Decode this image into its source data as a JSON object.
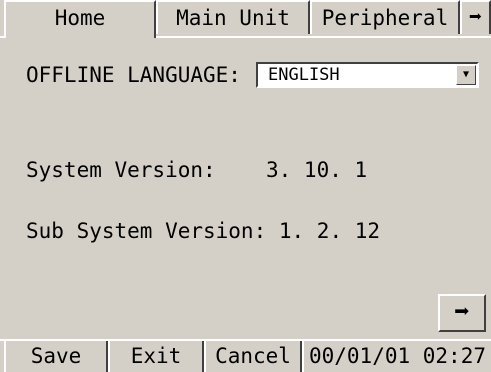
{
  "tabs": {
    "home": "Home",
    "main_unit": "Main Unit",
    "peripheral": "Peripheral",
    "more_icon": "right-arrow"
  },
  "settings": {
    "offline_language_label": "OFFLINE LANGUAGE:",
    "offline_language_value": "ENGLISH",
    "system_version_label": "System Version:",
    "system_version_value": "3. 10. 1",
    "sub_system_version_label": "Sub System Version:",
    "sub_system_version_value": "1. 2. 12"
  },
  "footer": {
    "save": "Save",
    "exit": "Exit",
    "cancel": "Cancel",
    "datetime": "00/01/01 02:27"
  },
  "colors": {
    "background": "#d4d0c8",
    "field": "#ffffff"
  }
}
